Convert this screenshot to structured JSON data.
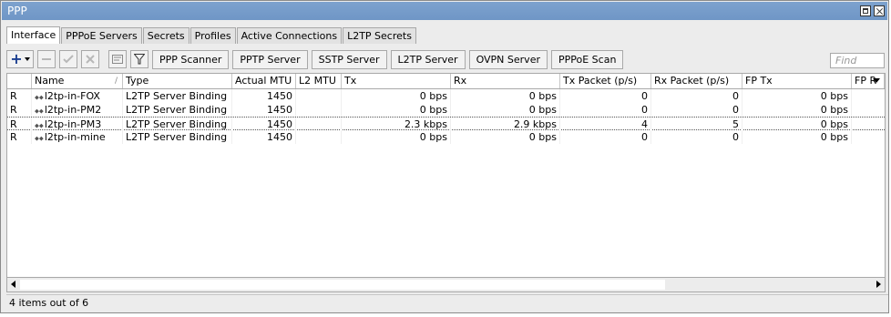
{
  "window": {
    "title": "PPP"
  },
  "tabs": [
    "Interface",
    "PPPoE Servers",
    "Secrets",
    "Profiles",
    "Active Connections",
    "L2TP Secrets"
  ],
  "toolbar": {
    "add_glyph": "+",
    "buttons": [
      "PPP Scanner",
      "PPTP Server",
      "SSTP Server",
      "L2TP Server",
      "OVPN Server",
      "PPPoE Scan"
    ]
  },
  "find_placeholder": "Find",
  "table": {
    "columns": [
      "",
      "Name",
      "Type",
      "Actual MTU",
      "L2 MTU",
      "Tx",
      "Rx",
      "Tx Packet (p/s)",
      "Rx Packet (p/s)",
      "FP Tx",
      "FP R"
    ],
    "sort_indicator": "/",
    "iface_glyph": "⬥⬥",
    "rows": [
      {
        "flag": "R",
        "name": "l2tp-in-FOX",
        "type": "L2TP Server Binding",
        "actual_mtu": "1450",
        "l2_mtu": "",
        "tx": "0 bps",
        "rx": "0 bps",
        "tx_pps": "0",
        "rx_pps": "0",
        "fp_tx": "0 bps"
      },
      {
        "flag": "R",
        "name": "l2tp-in-PM2",
        "type": "L2TP Server Binding",
        "actual_mtu": "1450",
        "l2_mtu": "",
        "tx": "0 bps",
        "rx": "0 bps",
        "tx_pps": "0",
        "rx_pps": "0",
        "fp_tx": "0 bps"
      },
      {
        "flag": "R",
        "name": "l2tp-in-PM3",
        "type": "L2TP Server Binding",
        "actual_mtu": "1450",
        "l2_mtu": "",
        "tx": "2.3 kbps",
        "rx": "2.9 kbps",
        "tx_pps": "4",
        "rx_pps": "5",
        "fp_tx": "0 bps"
      },
      {
        "flag": "R",
        "name": "l2tp-in-mine",
        "type": "L2TP Server Binding",
        "actual_mtu": "1450",
        "l2_mtu": "",
        "tx": "0 bps",
        "rx": "0 bps",
        "tx_pps": "0",
        "rx_pps": "0",
        "fp_tx": "0 bps"
      }
    ]
  },
  "status": "4 items out of 6",
  "colors": {
    "titlebar": "#6f96c6",
    "add_icon": "#1a3d8f"
  }
}
